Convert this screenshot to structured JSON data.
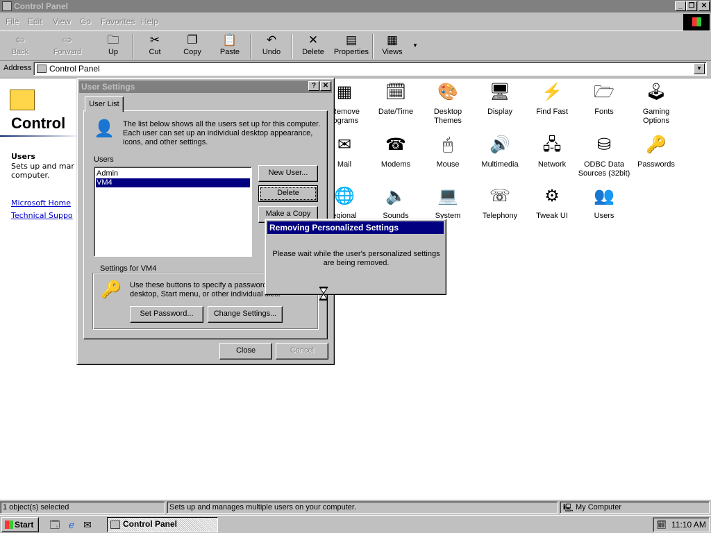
{
  "window": {
    "title": "Control Panel",
    "controls": {
      "minimize": "_",
      "maximize": "❐",
      "close": "✕"
    }
  },
  "menu": [
    "File",
    "Edit",
    "View",
    "Go",
    "Favorites",
    "Help"
  ],
  "toolbar": [
    {
      "label": "Back",
      "icon": "back-arrow-icon",
      "glyph": "⇦",
      "disabled": true
    },
    {
      "label": "Forward",
      "icon": "forward-arrow-icon",
      "glyph": "⇨",
      "disabled": true
    },
    {
      "label": "Up",
      "icon": "up-folder-icon",
      "glyph": "🗀",
      "disabled": false
    },
    {
      "label": "Cut",
      "icon": "scissors-icon",
      "glyph": "✂",
      "disabled": false
    },
    {
      "label": "Copy",
      "icon": "copy-icon",
      "glyph": "❐",
      "disabled": false
    },
    {
      "label": "Paste",
      "icon": "paste-icon",
      "glyph": "📋",
      "disabled": false
    },
    {
      "label": "Undo",
      "icon": "undo-icon",
      "glyph": "↶",
      "disabled": false
    },
    {
      "label": "Delete",
      "icon": "delete-x-icon",
      "glyph": "✕",
      "disabled": false
    },
    {
      "label": "Properties",
      "icon": "properties-icon",
      "glyph": "▤",
      "disabled": false
    },
    {
      "label": "Views",
      "icon": "views-icon",
      "glyph": "▦",
      "disabled": false
    }
  ],
  "address": {
    "label": "Address",
    "value": "Control Panel"
  },
  "left_panel": {
    "title": "Control",
    "users_heading": "Users",
    "users_desc": "Sets up and mar computer.",
    "link1": "Microsoft Home",
    "link2": "Technical Suppo"
  },
  "cp_items": [
    {
      "label": "/Remove\nrograms",
      "icon": "add-remove-programs-icon",
      "glyph": "▦"
    },
    {
      "label": "Date/Time",
      "icon": "calendar-clock-icon",
      "glyph": "🗓"
    },
    {
      "label": "Desktop\nThemes",
      "icon": "desktop-themes-icon",
      "glyph": "🎨"
    },
    {
      "label": "Display",
      "icon": "monitor-icon",
      "glyph": "🖥"
    },
    {
      "label": "Find Fast",
      "icon": "binoculars-icon",
      "glyph": "⚡"
    },
    {
      "label": "Fonts",
      "icon": "fonts-folder-icon",
      "glyph": "🗁"
    },
    {
      "label": "Gaming\nOptions",
      "icon": "joystick-icon",
      "glyph": "🕹"
    },
    {
      "label": "Mail",
      "icon": "mail-globe-icon",
      "glyph": "✉"
    },
    {
      "label": "Modems",
      "icon": "modem-phone-icon",
      "glyph": "☎"
    },
    {
      "label": "Mouse",
      "icon": "mouse-icon",
      "glyph": "🖱"
    },
    {
      "label": "Multimedia",
      "icon": "multimedia-icon",
      "glyph": "🔊"
    },
    {
      "label": "Network",
      "icon": "network-icon",
      "glyph": "🖧"
    },
    {
      "label": "ODBC Data\nSources (32bit)",
      "icon": "odbc-icon",
      "glyph": "⛁"
    },
    {
      "label": "Passwords",
      "icon": "keys-icon",
      "glyph": "🔑"
    },
    {
      "label": "egional",
      "icon": "regional-globe-icon",
      "glyph": "🌐"
    },
    {
      "label": "Sounds",
      "icon": "speaker-icon",
      "glyph": "🔈"
    },
    {
      "label": "System",
      "icon": "computer-icon",
      "glyph": "💻"
    },
    {
      "label": "Telephony",
      "icon": "telephony-icon",
      "glyph": "☏"
    },
    {
      "label": "Tweak UI",
      "icon": "tweak-ui-icon",
      "glyph": "⚙"
    },
    {
      "label": "Users",
      "icon": "users-icon",
      "glyph": "👥"
    }
  ],
  "status_bar": {
    "selected": "1 object(s) selected",
    "info": "Sets up and manages multiple users on your computer.",
    "location": "My Computer"
  },
  "taskbar": {
    "start": "Start",
    "task": "Control Panel",
    "clock": "11:10 AM"
  },
  "user_settings": {
    "title": "User Settings",
    "help_btn": "?",
    "close_btn": "✕",
    "tab": "User List",
    "intro": "The list below shows all the users set up for this computer. Each user can set up an individual desktop appearance, icons, and other settings.",
    "users_label": "Users",
    "users": [
      "Admin",
      "VM4"
    ],
    "selected_user": "VM4",
    "new_user": "New User...",
    "delete": "Delete",
    "make_copy": "Make a Copy",
    "settings_for": "Settings for VM4",
    "settings_desc": "Use these buttons to specify a password user's desktop, Start menu, or other individual files.",
    "set_password": "Set Password...",
    "change_settings": "Change Settings...",
    "close": "Close",
    "cancel": "Cancel"
  },
  "removing_dialog": {
    "title": "Removing Personalized Settings",
    "message": "Please wait while the user's personalized settings are being removed."
  }
}
